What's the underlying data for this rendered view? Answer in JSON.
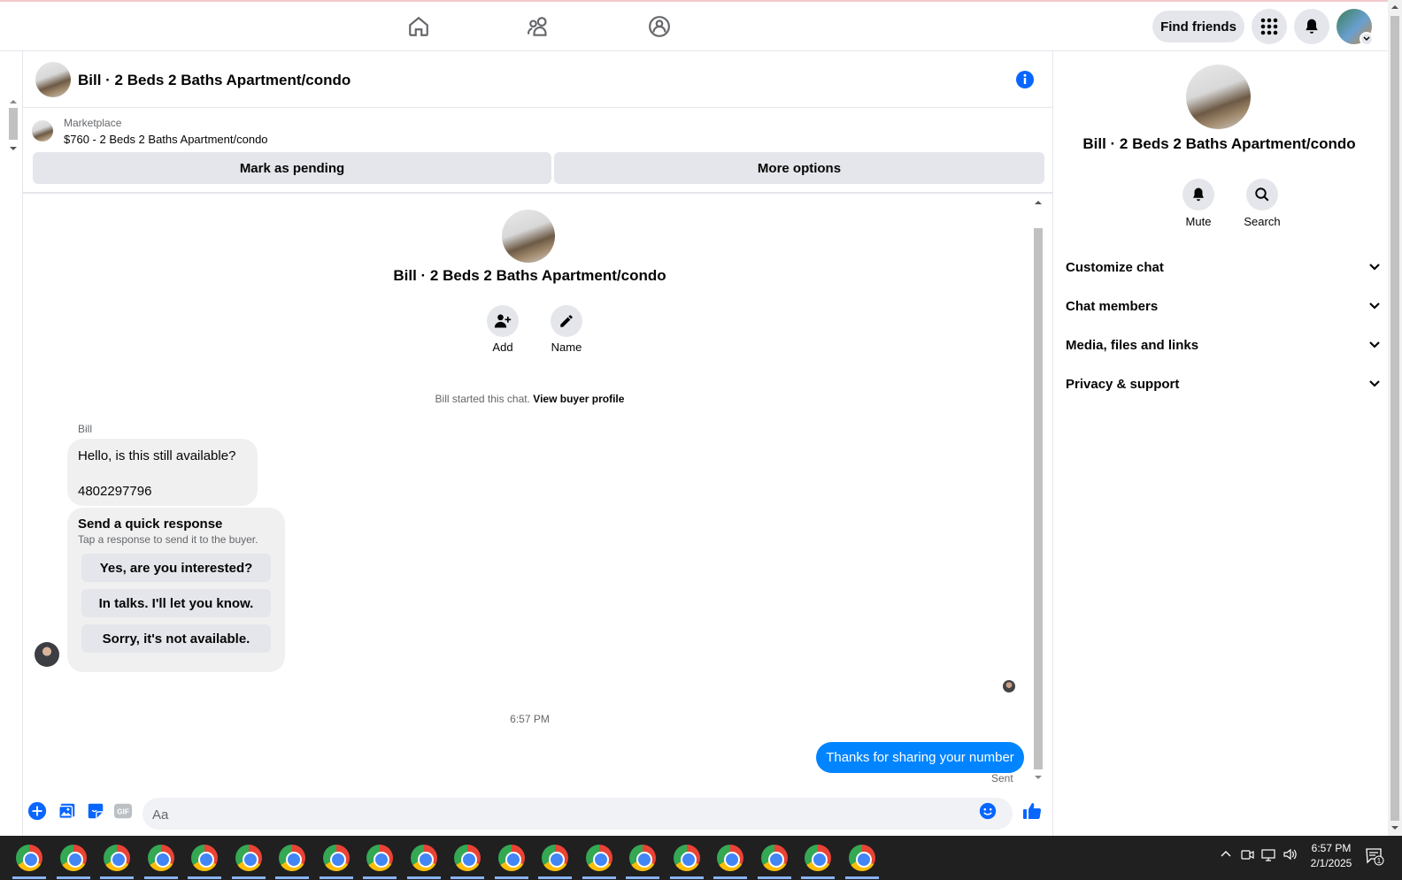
{
  "topnav": {
    "find_friends": "Find friends"
  },
  "header": {
    "title": "Bill · 2 Beds 2 Baths Apartment/condo"
  },
  "marketplace": {
    "label": "Marketplace",
    "listing": "$760 - 2 Beds 2 Baths Apartment/condo",
    "mark_pending": "Mark as pending",
    "more_options": "More options"
  },
  "conversation": {
    "title": "Bill · 2 Beds 2 Baths Apartment/condo",
    "add_label": "Add",
    "name_label": "Name",
    "started_text": "Bill started this chat.",
    "view_buyer_profile": "View buyer profile",
    "sender_name": "Bill",
    "message_line1": "Hello, is this still available?",
    "message_line2": "4802297796",
    "quick_response_title": "Send a quick response",
    "quick_response_subtitle": "Tap a response to send it to the buyer.",
    "quick_responses": [
      "Yes, are you interested?",
      "In talks. I'll let you know.",
      "Sorry, it's not available."
    ],
    "timestamp": "6:57 PM",
    "my_message": "Thanks for sharing your number",
    "sent_status": "Sent"
  },
  "composer": {
    "placeholder": "Aa",
    "gif_label": "GIF"
  },
  "right_panel": {
    "title": "Bill · 2 Beds 2 Baths Apartment/condo",
    "mute_label": "Mute",
    "search_label": "Search",
    "sections": [
      "Customize chat",
      "Chat members",
      "Media, files and links",
      "Privacy & support"
    ]
  },
  "taskbar": {
    "time": "6:57 PM",
    "date": "2/1/2025",
    "notification_count": "1",
    "app_count": 20
  },
  "colors": {
    "accent": "#0084ff",
    "icon_blue": "#0866ff",
    "taskbar_bg": "#202020"
  }
}
